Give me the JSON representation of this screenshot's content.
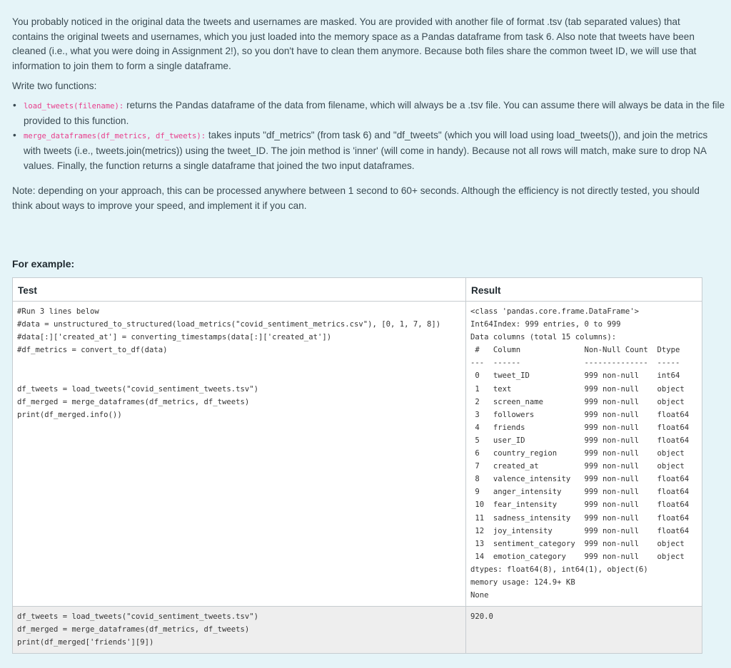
{
  "intro": {
    "paragraph": "You probably noticed in the original data the tweets and usernames are masked. You are provided with another file of format .tsv (tab separated values) that contains the original tweets and usernames, which you just loaded into the memory space as a Pandas dataframe from task 6. Also note that tweets have been cleaned (i.e., what you were doing in Assignment 2!), so you don't have to clean them anymore. Because both files share the common tweet ID, we will use that information to join them to form a single dataframe.",
    "write_two": "Write two functions:"
  },
  "functions": [
    {
      "signature": "load_tweets(filename):",
      "text": " returns the Pandas dataframe of the data from filename, which will always be a .tsv file. You can assume there will always be data in the file provided to this function."
    },
    {
      "signature": "merge_dataframes(df_metrics, df_tweets):",
      "text": " takes inputs \"df_metrics\" (from task 6) and \"df_tweets\" (which you will load using load_tweets()), and join the metrics with tweets (i.e., tweets.join(metrics)) using the tweet_ID. The join method is 'inner' (will come in handy). Because not all rows will match, make sure to drop NA values. Finally, the function returns a single dataframe that joined the two input dataframes."
    }
  ],
  "note": "Note: depending on your approach, this can be processed anywhere between 1 second to 60+ seconds. Although the efficiency is not directly tested, you should think about ways to improve your speed, and implement it if you can.",
  "example": {
    "heading": "For example:",
    "col_test": "Test",
    "col_result": "Result",
    "rows": [
      {
        "test": "#Run 3 lines below\n#data = unstructured_to_structured(load_metrics(\"covid_sentiment_metrics.csv\"), [0, 1, 7, 8])\n#data[:]['created_at'] = converting_timestamps(data[:]['created_at'])\n#df_metrics = convert_to_df(data)\n\n\ndf_tweets = load_tweets(\"covid_sentiment_tweets.tsv\")\ndf_merged = merge_dataframes(df_metrics, df_tweets)\nprint(df_merged.info())",
        "result": "<class 'pandas.core.frame.DataFrame'>\nInt64Index: 999 entries, 0 to 999\nData columns (total 15 columns):\n #   Column              Non-Null Count  Dtype  \n---  ------              --------------  -----  \n 0   tweet_ID            999 non-null    int64  \n 1   text                999 non-null    object \n 2   screen_name         999 non-null    object \n 3   followers           999 non-null    float64\n 4   friends             999 non-null    float64\n 5   user_ID             999 non-null    float64\n 6   country_region      999 non-null    object \n 7   created_at          999 non-null    object \n 8   valence_intensity   999 non-null    float64\n 9   anger_intensity     999 non-null    float64\n 10  fear_intensity      999 non-null    float64\n 11  sadness_intensity   999 non-null    float64\n 12  joy_intensity       999 non-null    float64\n 13  sentiment_category  999 non-null    object \n 14  emotion_category    999 non-null    object \ndtypes: float64(8), int64(1), object(6)\nmemory usage: 124.9+ KB\nNone"
      },
      {
        "test": "df_tweets = load_tweets(\"covid_sentiment_tweets.tsv\")\ndf_merged = merge_dataframes(df_metrics, df_tweets)\nprint(df_merged['friends'][9])",
        "result": "920.0"
      }
    ]
  }
}
